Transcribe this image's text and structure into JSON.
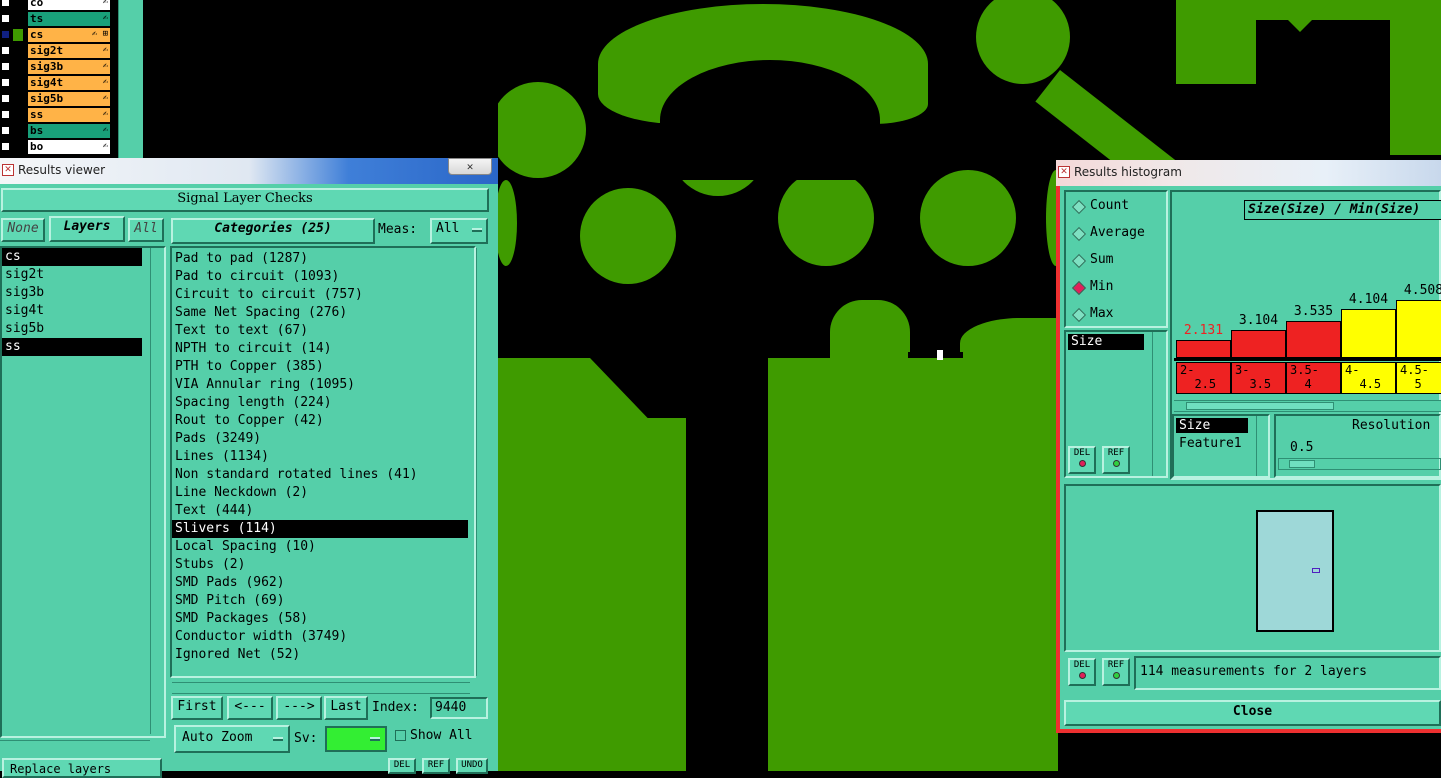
{
  "layers": [
    {
      "name": "co",
      "color": "#ffffff",
      "glyph": "✍"
    },
    {
      "name": "ts",
      "color": "#19a07a",
      "glyph": "✍"
    },
    {
      "name": "cs",
      "color": "#ffb347",
      "glyph": "✍ ⊞"
    },
    {
      "name": "sig2t",
      "color": "#ffb347",
      "glyph": "✍"
    },
    {
      "name": "sig3b",
      "color": "#ffb347",
      "glyph": "✍"
    },
    {
      "name": "sig4t",
      "color": "#ffb347",
      "glyph": "✍"
    },
    {
      "name": "sig5b",
      "color": "#ffb347",
      "glyph": "✍"
    },
    {
      "name": "ss",
      "color": "#ffb347",
      "glyph": "✍"
    },
    {
      "name": "bs",
      "color": "#19a07a",
      "glyph": "✍"
    },
    {
      "name": "bo",
      "color": "#ffffff",
      "glyph": "✍"
    }
  ],
  "results_viewer": {
    "title": "Results viewer",
    "close_label": "✕",
    "header": "Signal Layer Checks",
    "none_label": "None",
    "layers_label": "Layers",
    "all_label": "All",
    "categories_label": "Categories (25)",
    "meas_label": "Meas:",
    "meas_value": "All",
    "layer_items": [
      "cs",
      "sig2t",
      "sig3b",
      "sig4t",
      "sig5b",
      "ss"
    ],
    "categories": [
      "Pad to pad (1287)",
      "Pad to circuit (1093)",
      "Circuit to circuit (757)",
      "Same Net Spacing (276)",
      "Text to text (67)",
      "NPTH to circuit (14)",
      "PTH to Copper (385)",
      "VIA Annular ring (1095)",
      "Spacing length (224)",
      "Rout to Copper (42)",
      "Pads (3249)",
      "Lines (1134)",
      "Non standard rotated lines (41)",
      "Line Neckdown (2)",
      "Text (444)",
      "Slivers (114)",
      "Local Spacing (10)",
      "Stubs (2)",
      "SMD Pads (962)",
      "SMD Pitch (69)",
      "SMD Packages (58)",
      "Conductor width (3749)",
      "Ignored Net (52)"
    ],
    "selected_category": "Slivers (114)",
    "first_label": "First",
    "prev_label": "<---",
    "next_label": "--->",
    "last_label": "Last",
    "index_label": "Index:",
    "index_value": "9440",
    "auto_zoom_label": "Auto Zoom",
    "sv_label": "Sv:",
    "show_all_label": "Show All",
    "replace_layers_label": "Replace layers",
    "del_label": "DEL",
    "ref_label": "REF",
    "undo_label": "UNDO"
  },
  "histogram": {
    "title": "Results histogram",
    "modes": [
      "Count",
      "Average",
      "Sum",
      "Min",
      "Max"
    ],
    "selected_mode": "Min",
    "attr_list": [
      "Size"
    ],
    "chart_title": "Size(Size) / Min(Size)",
    "bars": [
      {
        "value": "2.131",
        "color": "#ee2222",
        "label_color": "#ee2222",
        "bucket": "2-\n  2.5"
      },
      {
        "value": "3.104",
        "color": "#ee2222",
        "label_color": "#000000",
        "bucket": "3-\n  3.5"
      },
      {
        "value": "3.535",
        "color": "#ee2222",
        "label_color": "#000000",
        "bucket": "3.5-\n  4"
      },
      {
        "value": "4.104",
        "color": "#ffff00",
        "label_color": "#000000",
        "bucket": "4-\n  4.5"
      },
      {
        "value": "4.508",
        "color": "#ffff00",
        "label_color": "#000000",
        "bucket": "4.5-\n  5"
      }
    ],
    "field_list": [
      "Size",
      "Feature1"
    ],
    "resolution_label": "Resolution",
    "resolution_value": "0.5",
    "status": "114 measurements for 2 layers",
    "close_label": "Close",
    "del_label": "DEL",
    "ref_label": "REF"
  }
}
